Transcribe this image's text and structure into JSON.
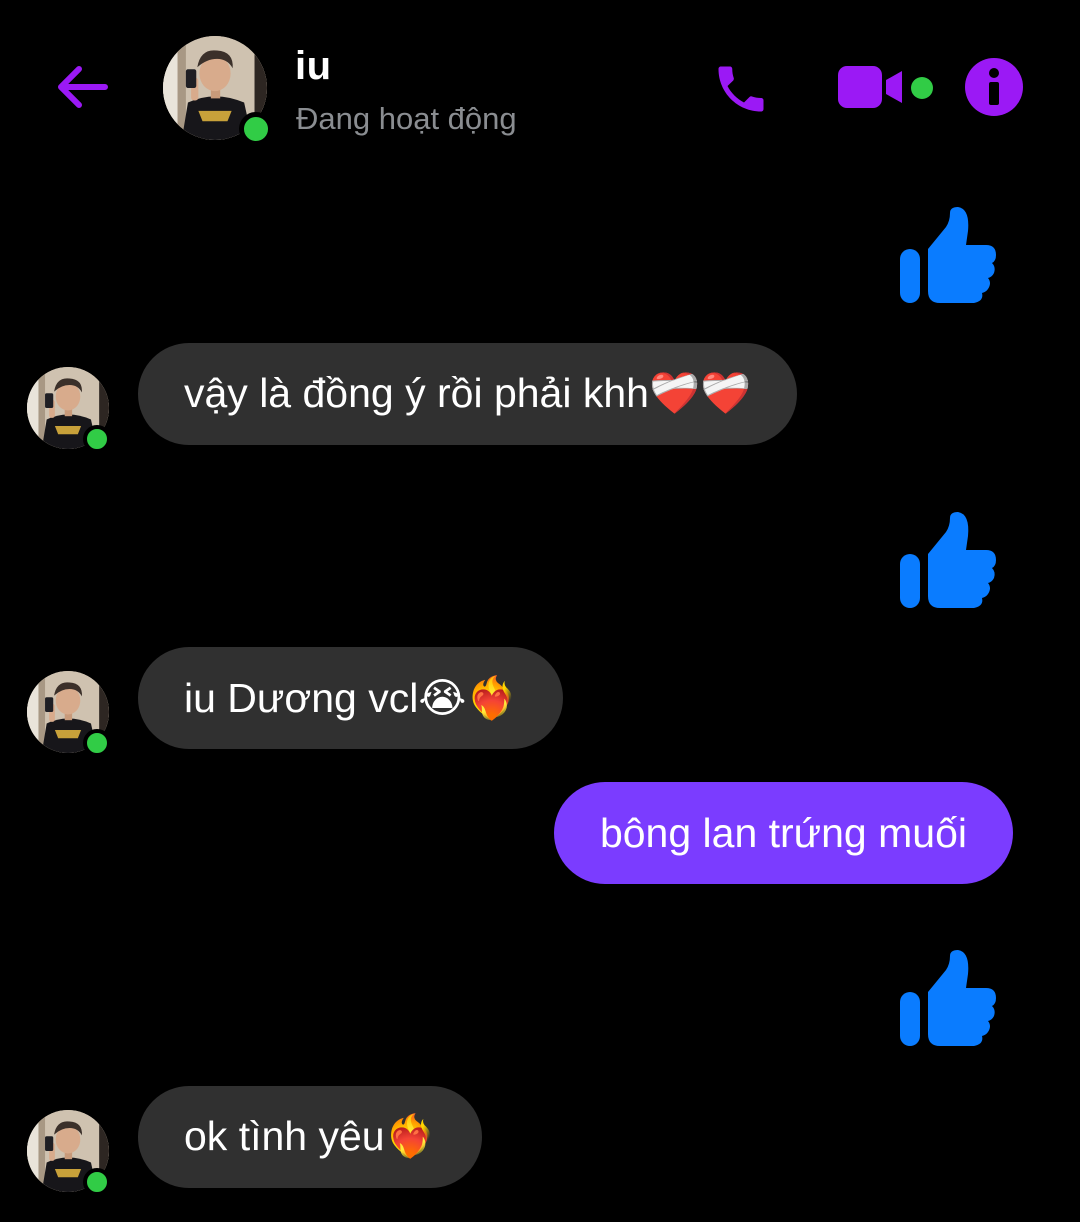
{
  "header": {
    "contact_name": "iu",
    "contact_status": "Đang hoạt động"
  },
  "colors": {
    "accent": "#9b19f5",
    "online": "#31cc46",
    "incoming_bubble": "#303030",
    "outgoing_bubble": "#7b3cff",
    "like": "#0a7cff",
    "status_text": "#8a8d91"
  },
  "icons": {
    "back": "arrow-left-icon",
    "call": "phone-icon",
    "video": "video-camera-icon",
    "info": "info-icon",
    "like": "thumbs-up-icon"
  },
  "messages": [
    {
      "type": "like",
      "from": "me"
    },
    {
      "type": "text",
      "from": "them",
      "text": "vậy là đồng ý rồi phải khh❤️‍🩹❤️‍🩹"
    },
    {
      "type": "like",
      "from": "me"
    },
    {
      "type": "text",
      "from": "them",
      "text": "iu Dương vcl😭❤️‍🔥"
    },
    {
      "type": "text",
      "from": "me",
      "text": "bông lan trứng muối"
    },
    {
      "type": "like",
      "from": "me"
    },
    {
      "type": "text",
      "from": "them",
      "text": "ok tình yêu❤️‍🔥"
    }
  ]
}
